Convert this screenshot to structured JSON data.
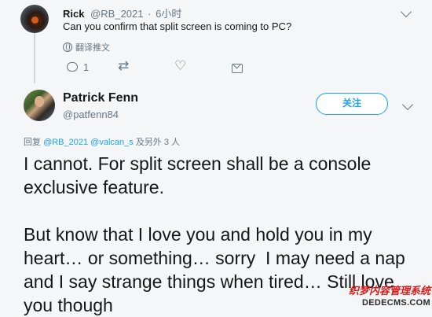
{
  "reply_tweet": {
    "author_name": "Rick",
    "author_handle": "@RB_2021",
    "separator": "·",
    "time": "6小时",
    "text": "Can you confirm that split screen is coming to PC?",
    "translate_label": "翻译推文",
    "reply_count": "1",
    "icons": [
      "avatar-photo",
      "chevron-down-icon",
      "globe-icon",
      "reply-icon",
      "retweet-icon",
      "like-icon",
      "dm-icon"
    ]
  },
  "main_tweet": {
    "author_name": "Patrick Fenn",
    "author_handle": "@patfenn84",
    "follow_label": "关注",
    "reply_to_prefix": "回复",
    "reply_to_mentions": "@RB_2021 @valcan_s",
    "reply_to_suffix": "及另外 3 人",
    "text": "I cannot. For split screen shall be a console exclusive feature.\n\nBut know that I love you and hold you in my heart… or something… sorry  I may need a nap and I say strange things when tired… Still love you though"
  },
  "watermark": {
    "line1": "织梦内容管理系统",
    "line2": "DEDECMS.COM"
  },
  "colors": {
    "accent": "#1da1f2",
    "text": "#14171a",
    "muted": "#657786",
    "background": "#f5f6f7",
    "watermark_red": "#d81b1b"
  }
}
